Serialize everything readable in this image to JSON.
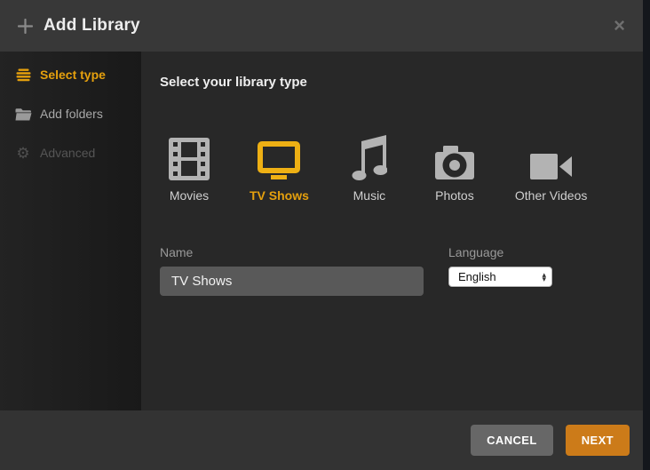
{
  "header": {
    "title": "Add Library"
  },
  "icons": {
    "close": "×",
    "gear": "⚙",
    "arrow_up": "▴",
    "arrow_down": "▾"
  },
  "sidebar": {
    "items": [
      {
        "label": "Select type",
        "state": "active"
      },
      {
        "label": "Add folders",
        "state": "default"
      },
      {
        "label": "Advanced",
        "state": "disabled"
      }
    ]
  },
  "main": {
    "heading": "Select your library type",
    "library_types": [
      {
        "label": "Movies",
        "selected": false
      },
      {
        "label": "TV Shows",
        "selected": true
      },
      {
        "label": "Music",
        "selected": false
      },
      {
        "label": "Photos",
        "selected": false
      },
      {
        "label": "Other Videos",
        "selected": false
      }
    ],
    "name_field": {
      "label": "Name",
      "value": "TV Shows"
    },
    "language_field": {
      "label": "Language",
      "value": "English"
    }
  },
  "footer": {
    "cancel_label": "CANCEL",
    "next_label": "NEXT"
  },
  "colors": {
    "accent_gold": "#e5a00d",
    "button_orange": "#cc7b19",
    "button_gray": "#676767",
    "header_bg": "#383838",
    "content_bg": "#282828",
    "footer_bg": "#333333",
    "sidebar_bg": "#1e1e1e",
    "input_bg": "#595959",
    "icon_gray": "#b3b3b3"
  }
}
